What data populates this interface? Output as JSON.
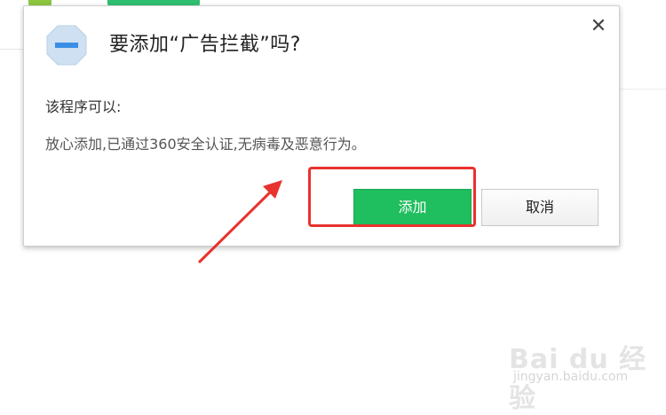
{
  "dialog": {
    "title": "要添加“广告拦截”吗?",
    "close_symbol": "✕",
    "permissions_label": "该程序可以:",
    "permissions_desc": "放心添加,已通过360安全认证,无病毒及恶意行为。",
    "add_label": "添加",
    "cancel_label": "取消",
    "icon": "no-entry-icon"
  },
  "colors": {
    "add_button": "#1fbe5e",
    "highlight": "#e8322e",
    "icon_fill": "#cfe0f2",
    "icon_bar": "#3a8ee6"
  },
  "watermark": {
    "text": "Bai du 经验",
    "sub": "jingyan.baidu.com"
  }
}
